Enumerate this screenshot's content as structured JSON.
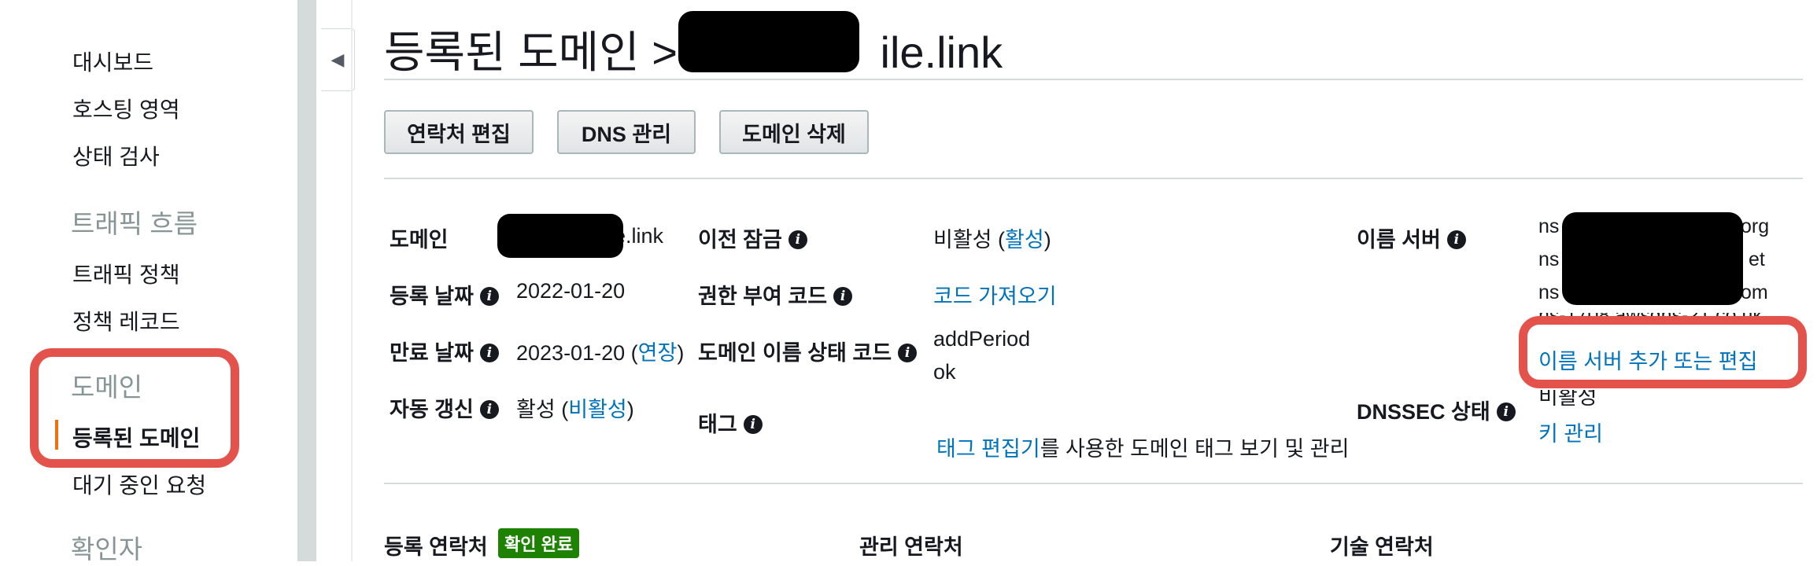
{
  "sidebar": {
    "items": [
      {
        "label": "대시보드"
      },
      {
        "label": "호스팅 영역"
      },
      {
        "label": "상태 검사"
      }
    ],
    "sections": [
      {
        "title": "트래픽 흐름",
        "items": [
          {
            "label": "트래픽 정책"
          },
          {
            "label": "정책 레코드"
          }
        ]
      },
      {
        "title": "도메인",
        "items": [
          {
            "label": "등록된 도메인"
          },
          {
            "label": "대기 중인 요청"
          }
        ]
      },
      {
        "title": "확인자"
      }
    ]
  },
  "header": {
    "breadcrumb": "등록된 도메인 >",
    "domain_suffix": "ile.link"
  },
  "toolbar": {
    "edit_contacts": "연락처 편집",
    "manage_dns": "DNS 관리",
    "delete_domain": "도메인 삭제"
  },
  "details": {
    "domain_label": "도메인",
    "domain_value": "e.link",
    "registered_label": "등록 날짜",
    "registered_value": "2022-01-20",
    "expires_label": "만료 날짜",
    "expires_value": "2023-01-20",
    "extend_link": "연장",
    "auto_renew_label": "자동 갱신",
    "auto_renew_value": "활성",
    "auto_renew_toggle": "비활성",
    "transfer_lock_label": "이전 잠금",
    "transfer_lock_value": "비활성",
    "transfer_lock_toggle": "활성",
    "auth_code_label": "권한 부여 코드",
    "auth_code_link": "코드 가져오기",
    "status_code_label": "도메인 이름 상태 코드",
    "status_codes": [
      "addPeriod",
      "ok"
    ],
    "tags_label": "태그",
    "tags_link": "태그 편집기",
    "tags_text": "를 사용한 도메인 태그 보기 및 관리",
    "nameservers_label": "이름 서버",
    "nameservers": [
      {
        "prefix": "ns",
        "suffix": "org"
      },
      {
        "prefix": "ns",
        "suffix": "et"
      },
      {
        "prefix": "ns",
        "suffix": "om"
      },
      {
        "prefix": "ns-1708.awsdns-21.co.uk",
        "suffix": ""
      }
    ],
    "nameservers_edit_link": "이름 서버 추가 또는 편집",
    "dnssec_label": "DNSSEC 상태",
    "dnssec_value": "비활성",
    "manage_keys_link": "키 관리"
  },
  "contacts": {
    "registrant_label": "등록 연락처",
    "verified_badge": "확인 완료",
    "admin_label": "관리 연락처",
    "tech_label": "기술 연락처"
  },
  "colors": {
    "link": "#0073bb",
    "highlight": "#e4524c",
    "active_bar": "#ec7211",
    "badge": "#1d8102"
  }
}
